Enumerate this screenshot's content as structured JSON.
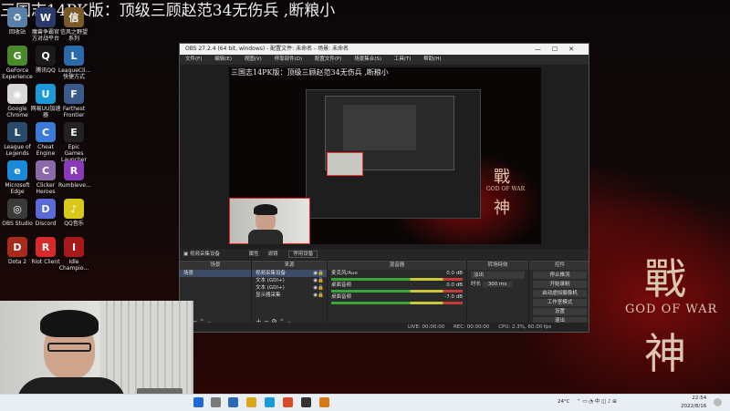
{
  "overlay": {
    "title": "三国志14PK版：顶级三顾赵范34无伤兵 ,断粮小"
  },
  "desktop": {
    "icons": [
      {
        "label": "回收站",
        "color": "#5a7fa8",
        "glyph": "♻"
      },
      {
        "label": "魔兽争霸官方对战平台",
        "color": "#2a3a6a",
        "glyph": "W"
      },
      {
        "label": "信风之野望系列",
        "color": "#7a5a2a",
        "glyph": "信"
      },
      {
        "label": "GeForce Experience",
        "color": "#4a8a2a",
        "glyph": "G"
      },
      {
        "label": "腾讯QQ",
        "color": "#1a1a1a",
        "glyph": "Q"
      },
      {
        "label": "LeagueCli... 快捷方式",
        "color": "#2a6aa8",
        "glyph": "L"
      },
      {
        "label": "Google Chrome",
        "color": "#d8d8d8",
        "glyph": "◉"
      },
      {
        "label": "网易UU加速器",
        "color": "#1a9ad8",
        "glyph": "U"
      },
      {
        "label": "Farthest Frontier",
        "color": "#3a5a8a",
        "glyph": "F"
      },
      {
        "label": "League of Legends",
        "color": "#2a4a6a",
        "glyph": "L"
      },
      {
        "label": "Cheat Engine",
        "color": "#3a7ad8",
        "glyph": "C"
      },
      {
        "label": "Epic Games Launcher",
        "color": "#222222",
        "glyph": "E"
      },
      {
        "label": "Microsoft Edge",
        "color": "#1a8ad8",
        "glyph": "e"
      },
      {
        "label": "Clicker Heroes",
        "color": "#8a6aa8",
        "glyph": "C"
      },
      {
        "label": "Rumbleve...",
        "color": "#8a3ab8",
        "glyph": "R"
      },
      {
        "label": "OBS Studio",
        "color": "#3a3a3a",
        "glyph": "◎"
      },
      {
        "label": "Discord",
        "color": "#5a6ad8",
        "glyph": "D"
      },
      {
        "label": "QQ音乐",
        "color": "#d8c81a",
        "glyph": "♪"
      },
      {
        "label": "Dota 2",
        "color": "#a82a1a",
        "glyph": "D"
      },
      {
        "label": "Riot Client",
        "color": "#d82a2a",
        "glyph": "R"
      },
      {
        "label": "Idle Champio...",
        "color": "#a81a1a",
        "glyph": "I"
      }
    ]
  },
  "wallpaper": {
    "logo_cn": "戰",
    "logo_cn2": "神",
    "logo_en": "GOD OF WAR"
  },
  "obs": {
    "title": "OBS 27.2.4 (64 bit, windows) - 配置文件: 未命名 - 场景: 未命名",
    "menu": [
      "文件(F)",
      "编辑(E)",
      "视图(V)",
      "停靠部件(D)",
      "配置文件(P)",
      "场景集合(S)",
      "工具(T)",
      "帮助(H)"
    ],
    "source_bar": {
      "name": "视频采集设备",
      "props": "属性",
      "filters": "滤镜",
      "device": "停用设备"
    },
    "scenes": {
      "header": "场景",
      "items": [
        "场景"
      ]
    },
    "sources": {
      "header": "来源",
      "items": [
        "视频采集设备",
        "文本 (GDI+)",
        "文本 (GDI+)",
        "显示器采集"
      ]
    },
    "mixer": {
      "header": "混音器",
      "ch1": "麦克风/Aux",
      "ch1_db": "0.0 dB",
      "ch2": "桌面音频",
      "ch2_db": "0.0 dB",
      "ch3": "桌面音频",
      "ch3_db": "-7.0 dB"
    },
    "transitions": {
      "header": "转场特效",
      "type": "淡出",
      "duration_label": "时长",
      "duration": "300 ms"
    },
    "controls": {
      "header": "控件",
      "buttons": [
        "停止推流",
        "开始录制",
        "启动虚拟摄像机",
        "工作室模式",
        "设置",
        "退出"
      ]
    },
    "status": {
      "live": "LIVE: 00:00:00",
      "rec": "REC: 00:00:00",
      "cpu": "CPU: 2.3%, 60.00 fps"
    }
  },
  "taskbar": {
    "weather": "24°C",
    "time": "22:54",
    "date": "2022/8/16"
  }
}
